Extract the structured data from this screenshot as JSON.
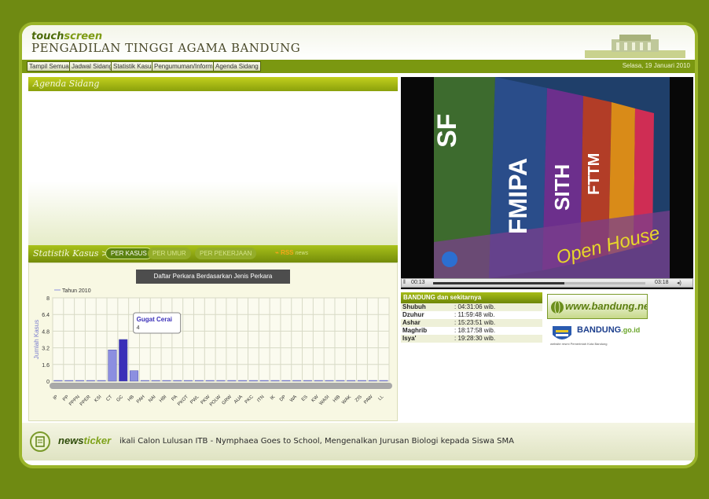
{
  "header": {
    "brand_a": "touch",
    "brand_b": "screen",
    "court": "PENGADILAN TINGGI AGAMA BANDUNG"
  },
  "nav": {
    "items": [
      "Tampil Semua",
      "Jadwal Sidang",
      "Statistik Kasus",
      "Pengumuman/Informasi",
      "Agenda Sidang"
    ],
    "date": "Selasa, 19 Januari 2010"
  },
  "agenda": {
    "title": "Agenda Sidang"
  },
  "stats": {
    "title": "Statistik Kasus >>",
    "tabs": [
      "PER KASUS",
      "PER UMUR",
      "PER PEKERJAAN"
    ],
    "rss": "RSS",
    "rss_note": "news"
  },
  "chart_data": {
    "type": "bar",
    "title": "Daftar Perkara Berdasarkan Jenis Perkara",
    "ylabel": "Jumlah Kasus",
    "xlabel": "",
    "legend": "Tahun 2010",
    "ylim": [
      0,
      8
    ],
    "yticks": [
      "0",
      "1.6",
      "3.2",
      "4.8",
      "6.4",
      "8"
    ],
    "categories": [
      "IP",
      "PP",
      "PPPN",
      "PPER",
      "KSI",
      "CT",
      "GC",
      "HB",
      "PAH",
      "NAI",
      "HBI",
      "PA",
      "PKOT",
      "PWL",
      "PKW",
      "POLW",
      "GRW",
      "AUA",
      "PKC",
      "ITN",
      "IK",
      "DP",
      "WA",
      "ES",
      "KW",
      "WASI",
      "HIB",
      "WAK",
      "ZIS",
      "PAW",
      "LL"
    ],
    "values": [
      0,
      0,
      0,
      0,
      0,
      3,
      4,
      1,
      0,
      0,
      0,
      0,
      0,
      0,
      0,
      0,
      0,
      0,
      0,
      0,
      0,
      0,
      0,
      0,
      0,
      0,
      0,
      0,
      0,
      0,
      0
    ],
    "tooltip": {
      "label": "Gugat Cerai",
      "value": "4"
    },
    "grid": true,
    "legend_position": "top-left",
    "colors": {
      "bar": "#8c8fe0",
      "bar_highlight": "#3a2fb8"
    }
  },
  "video": {
    "time_current": "00:13",
    "time_total": "03:18",
    "progress": 0.62
  },
  "prayer": {
    "title": "BANDUNG dan sekitarnya",
    "rows": [
      {
        "name": "Shubuh",
        "time": ": 04:31:06 wib."
      },
      {
        "name": "Dzuhur",
        "time": ": 11:59:48 wib."
      },
      {
        "name": "Ashar",
        "time": ": 15:23:51 wib."
      },
      {
        "name": "Maghrib",
        "time": ": 18:17:58 wib."
      },
      {
        "name": "Isya'",
        "time": ": 19:28:30 wib."
      }
    ]
  },
  "ads": {
    "ad1": "www.bandung.net",
    "ad2_a": "BANDUNG",
    "ad2_b": ".go.id",
    "ad2_sub": "website resmi Pemerintah Kota Bandung"
  },
  "ticker": {
    "logo_a": "news",
    "logo_b": "ticker",
    "message": "ikali Calon Lulusan ITB - Nymphaea Goes to School, Mengenalkan Jurusan Biologi kepada Siswa SMA"
  }
}
